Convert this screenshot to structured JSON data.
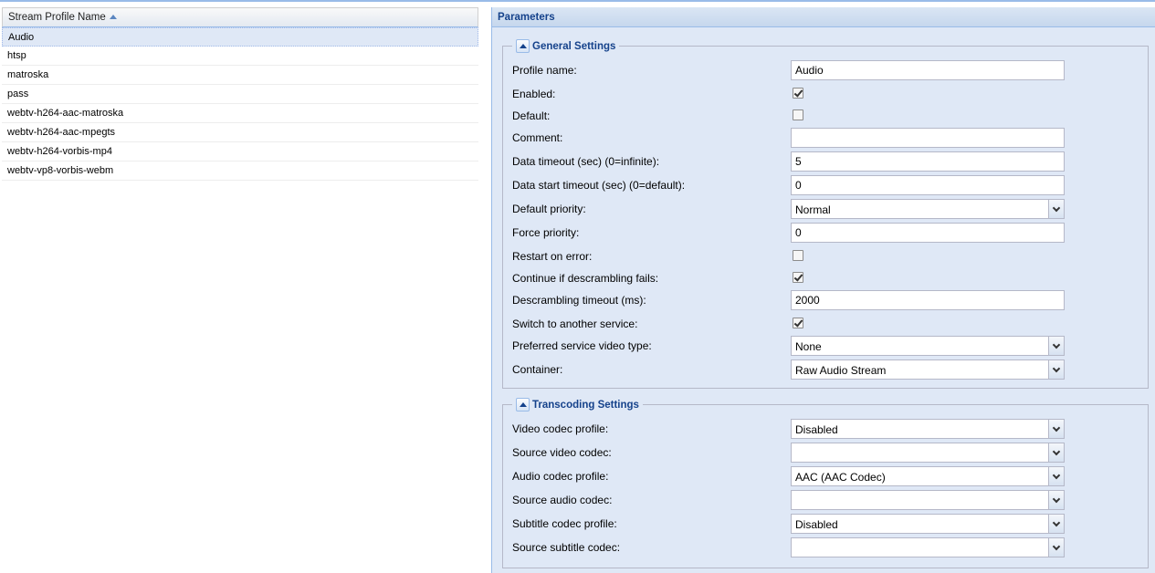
{
  "grid": {
    "header": "Stream Profile Name",
    "rows": [
      "Audio",
      "htsp",
      "matroska",
      "pass",
      "webtv-h264-aac-matroska",
      "webtv-h264-aac-mpegts",
      "webtv-h264-vorbis-mp4",
      "webtv-vp8-vorbis-webm"
    ],
    "selected": "Audio"
  },
  "panel": {
    "title": "Parameters",
    "general": {
      "title": "General Settings",
      "profile_name_label": "Profile name:",
      "profile_name_value": "Audio",
      "enabled_label": "Enabled:",
      "enabled": true,
      "default_label": "Default:",
      "default": false,
      "comment_label": "Comment:",
      "comment_value": "",
      "data_timeout_label": "Data timeout (sec) (0=infinite):",
      "data_timeout_value": "5",
      "data_start_timeout_label": "Data start timeout (sec) (0=default):",
      "data_start_timeout_value": "0",
      "default_priority_label": "Default priority:",
      "default_priority_value": "Normal",
      "force_priority_label": "Force priority:",
      "force_priority_value": "0",
      "restart_on_error_label": "Restart on error:",
      "restart_on_error": false,
      "continue_descrambling_label": "Continue if descrambling fails:",
      "continue_descrambling": true,
      "descrambling_timeout_label": "Descrambling timeout (ms):",
      "descrambling_timeout_value": "2000",
      "switch_service_label": "Switch to another service:",
      "switch_service": true,
      "preferred_video_type_label": "Preferred service video type:",
      "preferred_video_type_value": "None",
      "container_label": "Container:",
      "container_value": "Raw Audio Stream"
    },
    "transcoding": {
      "title": "Transcoding Settings",
      "video_codec_profile_label": "Video codec profile:",
      "video_codec_profile_value": "Disabled",
      "source_video_codec_label": "Source video codec:",
      "source_video_codec_value": "",
      "audio_codec_profile_label": "Audio codec profile:",
      "audio_codec_profile_value": "AAC (AAC Codec)",
      "source_audio_codec_label": "Source audio codec:",
      "source_audio_codec_value": "",
      "subtitle_codec_profile_label": "Subtitle codec profile:",
      "subtitle_codec_profile_value": "Disabled",
      "source_subtitle_codec_label": "Source subtitle codec:",
      "source_subtitle_codec_value": ""
    }
  }
}
